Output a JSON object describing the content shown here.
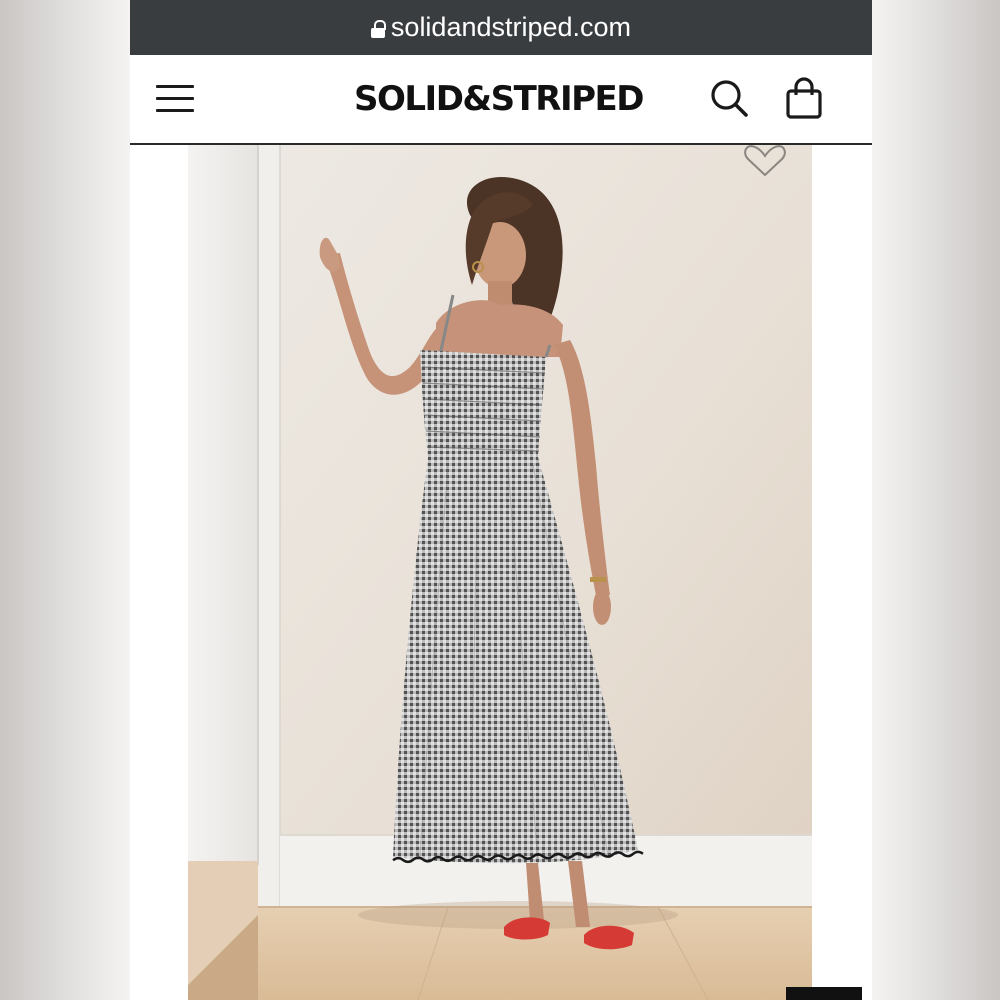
{
  "browser": {
    "url": "solidandstriped.com"
  },
  "header": {
    "logo": "SOLID&STRIPED"
  },
  "icons": {
    "lock": "lock-icon",
    "menu": "hamburger-menu-icon",
    "search": "search-icon",
    "bag": "shopping-bag-icon",
    "wishlist": "heart-icon"
  },
  "colors": {
    "url_bar": "#3a3d40",
    "header_bg": "#ffffff",
    "header_rule": "#2a2a2a",
    "sandals": "#d63a34"
  }
}
